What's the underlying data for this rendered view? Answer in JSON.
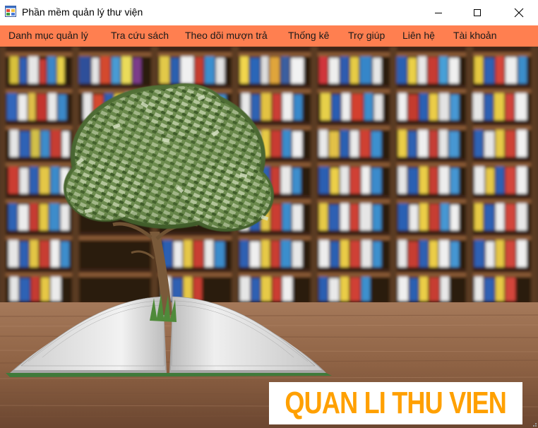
{
  "window": {
    "title": "Phần mềm quản lý thư viện"
  },
  "menu": {
    "items": [
      {
        "label": "Danh mục quản lý"
      },
      {
        "label": "Tra cứu sách"
      },
      {
        "label": "Theo dõi mượn trả"
      },
      {
        "label": "Thống kê"
      },
      {
        "label": "Trợ giúp"
      },
      {
        "label": "Liên hệ"
      },
      {
        "label": "Tài khoản"
      }
    ]
  },
  "banner": {
    "text": "QUAN LI THU VIEN"
  },
  "colors": {
    "menubar": "#ff7f50",
    "banner_text": "#ffa000",
    "banner_bg": "#ffffff"
  },
  "icons": {
    "app": "windows-forms-icon",
    "minimize": "minimize-icon",
    "maximize": "maximize-icon",
    "close": "close-icon"
  }
}
